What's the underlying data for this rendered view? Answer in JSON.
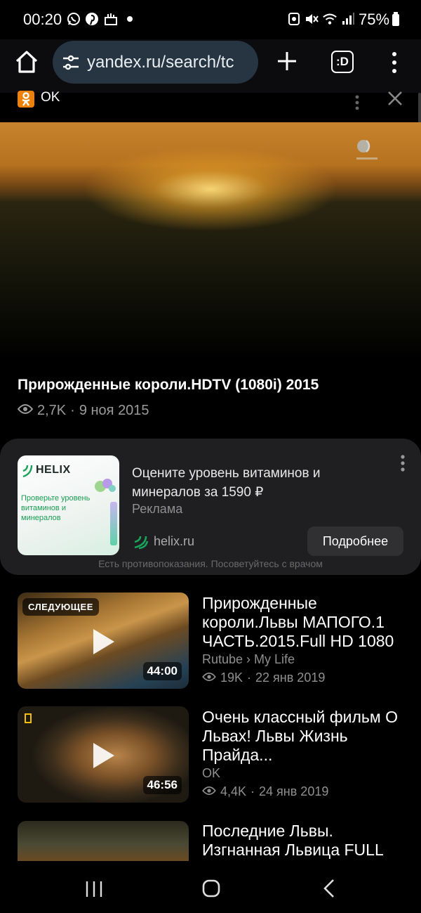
{
  "status_bar": {
    "time": "00:20",
    "battery": "75%",
    "left_icons": [
      "whatsapp-icon",
      "pinterest-icon",
      "notification-icon",
      "dot-icon"
    ],
    "right_icons": [
      "screenshot-icon",
      "mute-icon",
      "wifi-icon",
      "signal-icon",
      "battery-icon"
    ]
  },
  "browser": {
    "url": "yandex.ru/search/tc",
    "tabs_label": ":D"
  },
  "source_header": {
    "label": "OK"
  },
  "main_video": {
    "title": "Прирожденные короли.HDTV (1080i) 2015",
    "views": "2,7K",
    "date": "9 ноя 2015"
  },
  "ad": {
    "brand": "HELIX",
    "image_text": "Проверьте уровень витаминов и минералов",
    "title": "Оцените уровень витаминов и минералов за 1590 ₽",
    "label": "Реклама",
    "domain": "helix.ru",
    "button": "Подробнее",
    "disclaimer": "Есть противопоказания. Посоветуйтесь с врачом"
  },
  "related": [
    {
      "badge": "СЛЕДУЮЩЕЕ",
      "duration": "44:00",
      "title": "Прирожденные короли.Львы МАПОГО.1 ЧАСТЬ.2015.Full HD 1080",
      "source": "Rutube › My Life",
      "views": "19K",
      "date": "22 янв 2019"
    },
    {
      "duration": "46:56",
      "title": "Очень классный фильм О Львах! Львы Жизнь Прайда...",
      "source": "OK",
      "views": "4,4K",
      "date": "24 янв 2019"
    },
    {
      "title": "Последние Львы. Изгнанная Львица FULL"
    }
  ]
}
